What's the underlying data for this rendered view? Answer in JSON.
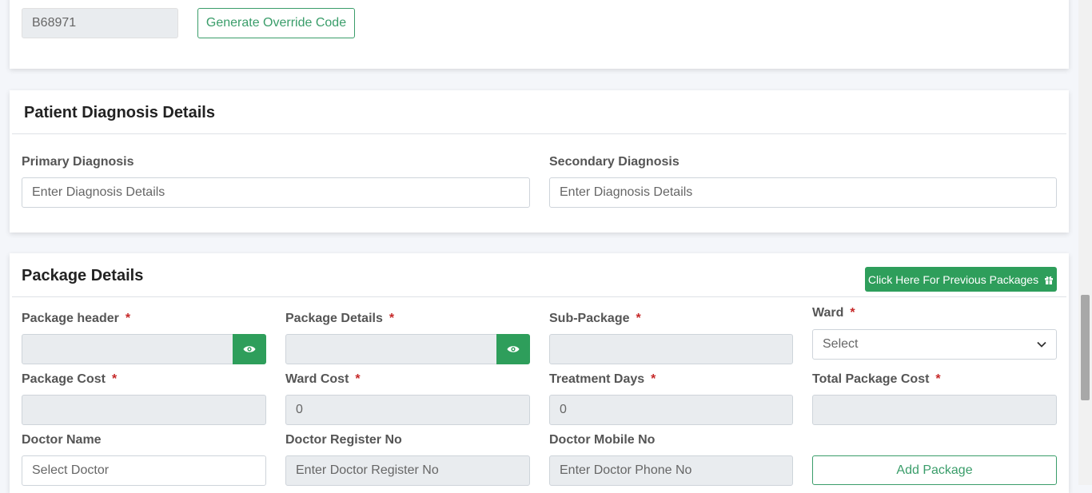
{
  "override": {
    "code_value": "B68971",
    "generate_button": "Generate Override Code"
  },
  "diagnosis": {
    "title": "Patient Diagnosis Details",
    "primary_label": "Primary Diagnosis",
    "primary_placeholder": "Enter Diagnosis Details",
    "secondary_label": "Secondary Diagnosis",
    "secondary_placeholder": "Enter Diagnosis Details"
  },
  "package": {
    "title": "Package Details",
    "previous_button": "Click Here For Previous Packages",
    "required_mark": "*",
    "package_header_label": "Package header",
    "package_details_label": "Package Details",
    "sub_package_label": "Sub-Package",
    "ward_label": "Ward",
    "ward_selected": "Select",
    "package_cost_label": "Package Cost",
    "ward_cost_label": "Ward Cost",
    "ward_cost_value": "0",
    "treatment_days_label": "Treatment Days",
    "treatment_days_value": "0",
    "total_cost_label": "Total Package Cost",
    "doctor_name_label": "Doctor Name",
    "doctor_name_placeholder": "Select Doctor",
    "doctor_reg_label": "Doctor Register No",
    "doctor_reg_placeholder": "Enter Doctor Register No",
    "doctor_mobile_label": "Doctor Mobile No",
    "doctor_mobile_placeholder": "Enter Doctor Phone No",
    "add_button": "Add Package"
  },
  "colors": {
    "accent_green": "#2e9e5b",
    "outline_green": "#3a9d6a",
    "required_red": "#c62828"
  },
  "icons": [
    "eye-icon",
    "gift-icon",
    "chevron-down-icon"
  ]
}
